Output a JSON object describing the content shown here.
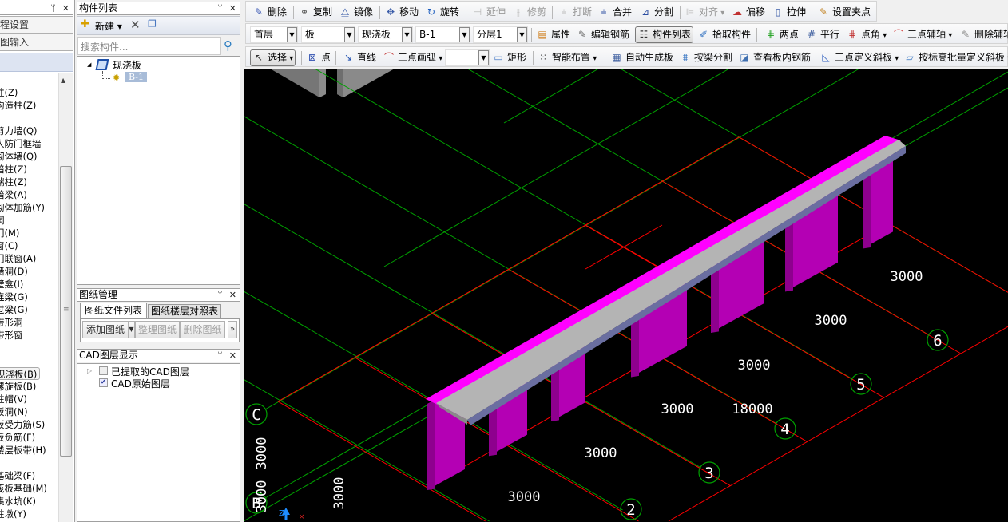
{
  "left_panel": {
    "buttons": [
      "工程设置",
      "绘图输入"
    ],
    "items": [
      "柱(Z)",
      "构造柱(Z)",
      "",
      "剪力墙(Q)",
      "人防门框墙",
      "砌体墙(Q)",
      "暗柱(Z)",
      "端柱(Z)",
      "暗梁(A)",
      "砌体加筋(Y)",
      "洞",
      "门(M)",
      "窗(C)",
      "门联窗(A)",
      "墙洞(D)",
      "壁龛(I)",
      "连梁(G)",
      "过梁(G)",
      "带形洞",
      "带形窗",
      "",
      "",
      "现浇板(B)",
      "螺旋板(B)",
      "柱帽(V)",
      "板洞(N)",
      "板受力筋(S)",
      "板负筋(F)",
      "楼层板带(H)",
      "",
      "基础梁(F)",
      "筏板基础(M)",
      "集水坑(K)",
      "柱墩(Y)"
    ],
    "selected": "现浇板(B)"
  },
  "component_list": {
    "title": "构件列表",
    "new_label": "新建",
    "search_placeholder": "搜索构件...",
    "tree_root": "现浇板",
    "tree_child": "B-1"
  },
  "drawing_mgmt": {
    "title": "图纸管理",
    "tabs": [
      "图纸文件列表",
      "图纸楼层对照表"
    ],
    "buttons": [
      "添加图纸",
      "整理图纸",
      "删除图纸"
    ],
    "more": "»"
  },
  "cad_layers": {
    "title": "CAD图层显示",
    "items": [
      {
        "label": "已提取的CAD图层",
        "checked": false
      },
      {
        "label": "CAD原始图层",
        "checked": true
      }
    ]
  },
  "toolbar1": [
    {
      "label": "删除",
      "icon": "eraser-icon"
    },
    {
      "label": "复制",
      "icon": "copy-icon"
    },
    {
      "label": "镜像",
      "icon": "mirror-icon"
    },
    {
      "label": "移动",
      "icon": "move-icon"
    },
    {
      "label": "旋转",
      "icon": "rotate-icon"
    },
    {
      "label": "延伸",
      "icon": "extend-icon",
      "disabled": true
    },
    {
      "label": "修剪",
      "icon": "trim-icon",
      "disabled": true
    },
    {
      "label": "打断",
      "icon": "break-icon",
      "disabled": true
    },
    {
      "label": "合并",
      "icon": "merge-icon"
    },
    {
      "label": "分割",
      "icon": "split-icon"
    },
    {
      "label": "对齐",
      "icon": "align-icon",
      "disabled": true,
      "dropdown": true
    },
    {
      "label": "偏移",
      "icon": "offset-icon"
    },
    {
      "label": "拉伸",
      "icon": "stretch-icon"
    },
    {
      "label": "设置夹点",
      "icon": "grip-icon"
    }
  ],
  "toolbar2": {
    "selects": [
      "首层",
      "板",
      "现浇板",
      "B-1",
      "分层1"
    ],
    "buttons": [
      {
        "label": "属性",
        "icon": "properties-icon"
      },
      {
        "label": "编辑钢筋",
        "icon": "edit-rebar-icon"
      },
      {
        "label": "构件列表",
        "icon": "component-list-icon",
        "pressed": true
      },
      {
        "label": "拾取构件",
        "icon": "pick-icon"
      },
      {
        "label": "两点",
        "icon": "two-point-icon"
      },
      {
        "label": "平行",
        "icon": "parallel-icon"
      },
      {
        "label": "点角",
        "icon": "point-angle-icon",
        "dropdown": true
      },
      {
        "label": "三点辅轴",
        "icon": "three-point-axis-icon",
        "dropdown": true
      },
      {
        "label": "删除辅轴",
        "icon": "delete-axis-icon"
      }
    ]
  },
  "toolbar3": {
    "buttons": [
      {
        "label": "选择",
        "icon": "cursor-icon",
        "pressed": true,
        "dropdown": true
      },
      {
        "label": "点",
        "icon": "point-icon"
      },
      {
        "label": "直线",
        "icon": "line-icon"
      },
      {
        "label": "三点画弧",
        "icon": "arc-icon",
        "dropdown": true
      },
      {
        "label": "矩形",
        "icon": "rectangle-icon"
      },
      {
        "label": "智能布置",
        "icon": "smart-layout-icon",
        "dropdown": true
      },
      {
        "label": "自动生成板",
        "icon": "auto-slab-icon"
      },
      {
        "label": "按梁分割",
        "icon": "beam-split-icon"
      },
      {
        "label": "查看板内钢筋",
        "icon": "view-rebar-icon"
      },
      {
        "label": "三点定义斜板",
        "icon": "slope-slab-icon",
        "dropdown": true
      },
      {
        "label": "按标高批量定义斜板",
        "icon": "batch-slope-icon",
        "dropdown": true
      }
    ],
    "select_value": ""
  },
  "viewport": {
    "dimensions": [
      "3000",
      "3000",
      "3000",
      "3000",
      "3000",
      "3000",
      "18000",
      "3000",
      "3000",
      "3000"
    ],
    "number_axes": [
      "2",
      "3",
      "4",
      "5",
      "6"
    ],
    "letter_axes": [
      "C",
      "B"
    ],
    "axis_indicator": "Z",
    "colors": {
      "background": "#000000",
      "grid": "#00a000",
      "slab_outline": "#ff0000",
      "column": "#b400b4",
      "slab_edge": "#ff00ff",
      "slab_top": "#b4b4b4",
      "slab_side": "#6a6ea0"
    }
  }
}
